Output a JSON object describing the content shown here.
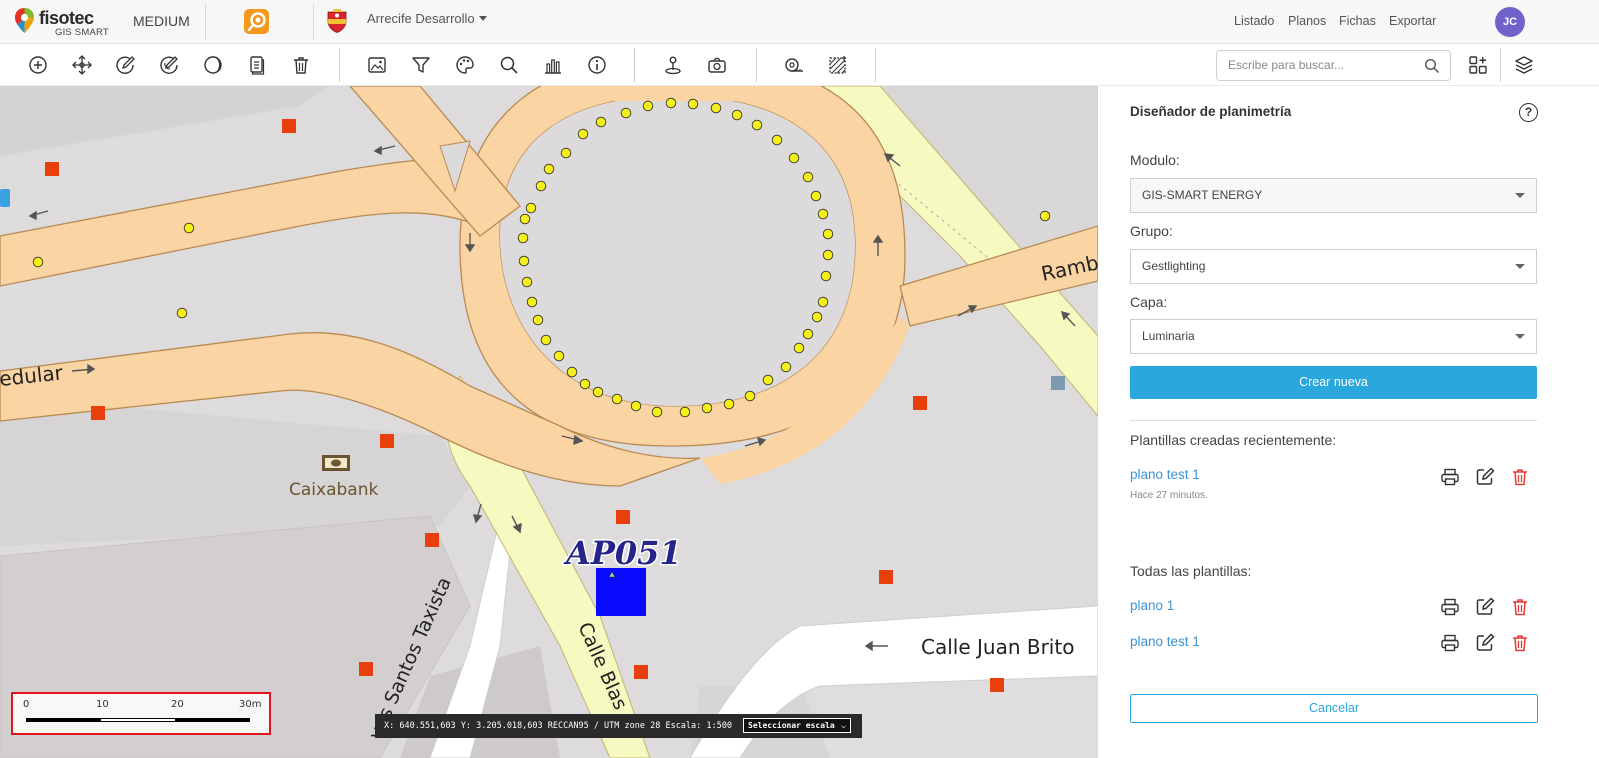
{
  "header": {
    "logo_text": "fisotec",
    "logo_subtext": "GIS SMART",
    "plan": "MEDIUM",
    "environment": "Arrecife Desarrollo",
    "nav": [
      "Listado",
      "Planos",
      "Fichas",
      "Exportar"
    ],
    "user_initials": "JC"
  },
  "toolbar": {
    "search_placeholder": "Escribe para buscar..."
  },
  "map": {
    "labels": {
      "street_left": "edular",
      "street_right": "Ramb",
      "bank": "Caixabank",
      "street_diag_left": "ves Santos Taxista",
      "street_diag_center": "Calle Blas",
      "street_bottom": "Calle Juan Brito",
      "asset": "AP051"
    },
    "scale_ticks": [
      "0",
      "10",
      "20",
      "30m"
    ],
    "coords_text": "X: 640.551,603 Y: 3.205.018,603   RECCAN95 / UTM zone 28   Escala: 1:500",
    "scale_select": "Seleccionar escala"
  },
  "panel": {
    "title": "Diseñador de planimetría",
    "help": "?",
    "modulo_label": "Modulo:",
    "modulo_value": "GIS-SMART ENERGY",
    "grupo_label": "Grupo:",
    "grupo_value": "Gestlighting",
    "capa_label": "Capa:",
    "capa_value": "Luminaria",
    "create_button": "Crear nueva",
    "recent_heading": "Plantillas creadas recientemente:",
    "recent": [
      {
        "name": "plano test 1",
        "time": "Hace 27 minutos."
      }
    ],
    "all_heading": "Todas las plantillas:",
    "all": [
      {
        "name": "plano 1"
      },
      {
        "name": "plano test 1"
      }
    ],
    "cancel_button": "Cancelar"
  },
  "colors": {
    "accent": "#2aa7dc",
    "link": "#3a93d6",
    "delete": "#e53935",
    "avatar": "#6f62c9",
    "road_primary": "#fcd6a4",
    "road_secondary": "#f7fabf"
  }
}
